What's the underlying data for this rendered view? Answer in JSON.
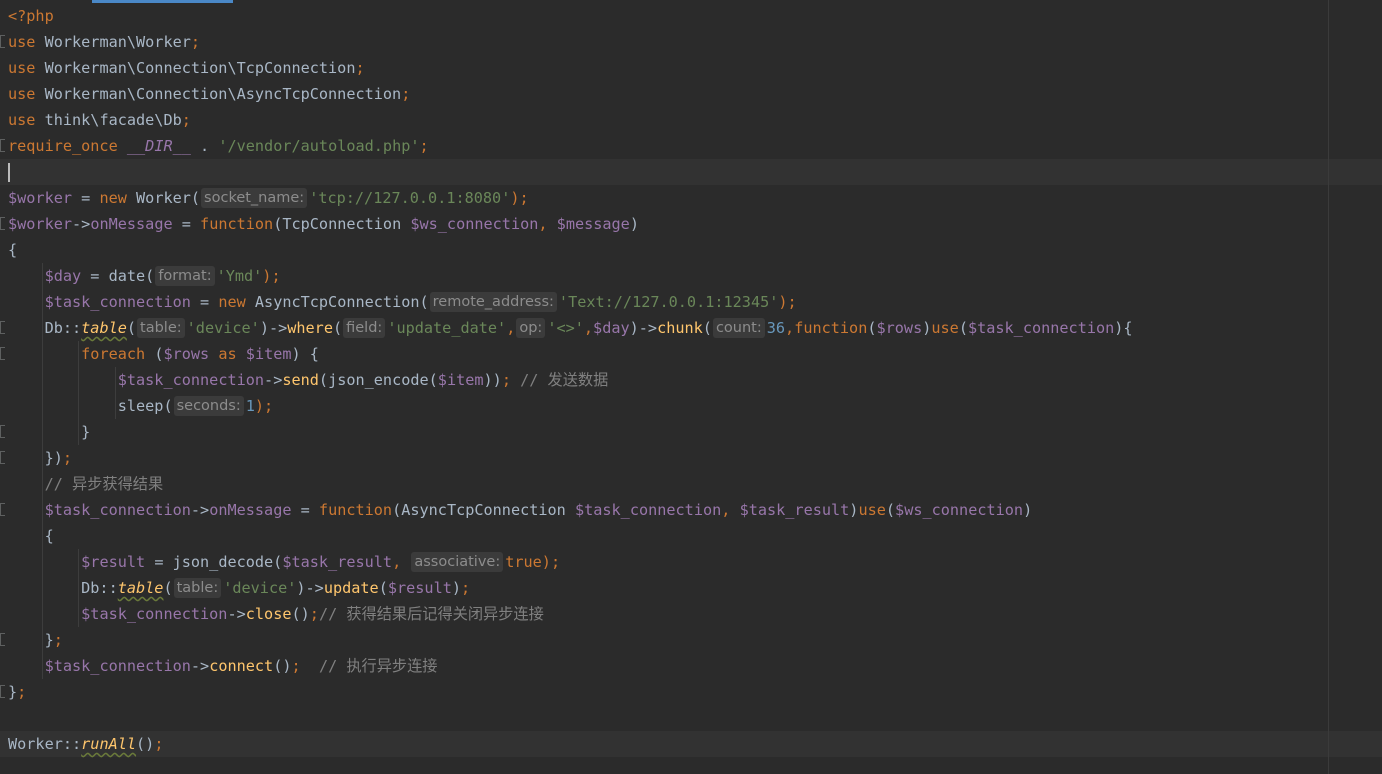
{
  "editor": {
    "lines": [
      [
        {
          "t": "<?php",
          "c": "kw"
        }
      ],
      [
        {
          "t": "use",
          "c": "kw"
        },
        {
          "t": " Workerman\\Worker",
          "c": "txt"
        },
        {
          "t": ";",
          "c": "kw"
        }
      ],
      [
        {
          "t": "use",
          "c": "kw"
        },
        {
          "t": " Workerman\\Connection\\TcpConnection",
          "c": "txt"
        },
        {
          "t": ";",
          "c": "kw"
        }
      ],
      [
        {
          "t": "use",
          "c": "kw"
        },
        {
          "t": " Workerman\\Connection\\AsyncTcpConnection",
          "c": "txt"
        },
        {
          "t": ";",
          "c": "kw"
        }
      ],
      [
        {
          "t": "use",
          "c": "kw"
        },
        {
          "t": " think\\facade\\Db",
          "c": "txt"
        },
        {
          "t": ";",
          "c": "kw"
        }
      ],
      [
        {
          "t": "require_once",
          "c": "kw"
        },
        {
          "t": " ",
          "c": "txt"
        },
        {
          "t": "__DIR__",
          "c": "magic"
        },
        {
          "t": " . ",
          "c": "txt"
        },
        {
          "t": "'/vendor/autoload.php'",
          "c": "str"
        },
        {
          "t": ";",
          "c": "kw"
        }
      ],
      [],
      [
        {
          "t": "$worker",
          "c": "var"
        },
        {
          "t": " = ",
          "c": "txt"
        },
        {
          "t": "new",
          "c": "kw"
        },
        {
          "t": " Worker(",
          "c": "txt"
        },
        {
          "t": "socket_name:",
          "c": "hint"
        },
        {
          "t": "'tcp://127.0.0.1:8080'",
          "c": "str"
        },
        {
          "t": ");",
          "c": "kw"
        }
      ],
      [
        {
          "t": "$worker",
          "c": "var"
        },
        {
          "t": "->",
          "c": "txt"
        },
        {
          "t": "onMessage",
          "c": "var"
        },
        {
          "t": " = ",
          "c": "txt"
        },
        {
          "t": "function",
          "c": "kw"
        },
        {
          "t": "(TcpConnection ",
          "c": "txt"
        },
        {
          "t": "$ws_connection",
          "c": "var"
        },
        {
          "t": ", ",
          "c": "kw"
        },
        {
          "t": "$message",
          "c": "var"
        },
        {
          "t": ")",
          "c": "txt"
        }
      ],
      [
        {
          "t": "{",
          "c": "txt"
        }
      ],
      [
        {
          "t": "    ",
          "c": "txt"
        },
        {
          "t": "$day",
          "c": "var"
        },
        {
          "t": " = date(",
          "c": "txt"
        },
        {
          "t": "format:",
          "c": "hint"
        },
        {
          "t": "'Ymd'",
          "c": "str"
        },
        {
          "t": ");",
          "c": "kw"
        }
      ],
      [
        {
          "t": "    ",
          "c": "txt"
        },
        {
          "t": "$task_connection",
          "c": "var"
        },
        {
          "t": " = ",
          "c": "txt"
        },
        {
          "t": "new",
          "c": "kw"
        },
        {
          "t": " AsyncTcpConnection(",
          "c": "txt"
        },
        {
          "t": "remote_address:",
          "c": "hint"
        },
        {
          "t": "'Text://127.0.0.1:12345'",
          "c": "str"
        },
        {
          "t": ");",
          "c": "kw"
        }
      ],
      [
        {
          "t": "    Db::",
          "c": "txt"
        },
        {
          "t": "table",
          "c": "stfn"
        },
        {
          "t": "(",
          "c": "txt"
        },
        {
          "t": "table:",
          "c": "hint"
        },
        {
          "t": "'device'",
          "c": "str"
        },
        {
          "t": ")->",
          "c": "txt"
        },
        {
          "t": "where",
          "c": "fn"
        },
        {
          "t": "(",
          "c": "txt"
        },
        {
          "t": "field:",
          "c": "hint"
        },
        {
          "t": "'update_date'",
          "c": "str"
        },
        {
          "t": ",",
          "c": "kw"
        },
        {
          "t": "op:",
          "c": "hint"
        },
        {
          "t": "'<>'",
          "c": "str"
        },
        {
          "t": ",",
          "c": "kw"
        },
        {
          "t": "$day",
          "c": "var"
        },
        {
          "t": ")->",
          "c": "txt"
        },
        {
          "t": "chunk",
          "c": "fn"
        },
        {
          "t": "(",
          "c": "txt"
        },
        {
          "t": "count:",
          "c": "hint"
        },
        {
          "t": "36",
          "c": "num"
        },
        {
          "t": ",",
          "c": "kw"
        },
        {
          "t": "function",
          "c": "kw"
        },
        {
          "t": "(",
          "c": "txt"
        },
        {
          "t": "$rows",
          "c": "var"
        },
        {
          "t": ")",
          "c": "txt"
        },
        {
          "t": "use",
          "c": "kw"
        },
        {
          "t": "(",
          "c": "txt"
        },
        {
          "t": "$task_connection",
          "c": "var"
        },
        {
          "t": "){",
          "c": "txt"
        }
      ],
      [
        {
          "t": "        ",
          "c": "txt"
        },
        {
          "t": "foreach",
          "c": "kw"
        },
        {
          "t": " (",
          "c": "txt"
        },
        {
          "t": "$rows",
          "c": "var"
        },
        {
          "t": " ",
          "c": "txt"
        },
        {
          "t": "as",
          "c": "kw"
        },
        {
          "t": " ",
          "c": "txt"
        },
        {
          "t": "$item",
          "c": "var"
        },
        {
          "t": ") {",
          "c": "txt"
        }
      ],
      [
        {
          "t": "            ",
          "c": "txt"
        },
        {
          "t": "$task_connection",
          "c": "var"
        },
        {
          "t": "->",
          "c": "txt"
        },
        {
          "t": "send",
          "c": "fn"
        },
        {
          "t": "(json_encode(",
          "c": "txt"
        },
        {
          "t": "$item",
          "c": "var"
        },
        {
          "t": "))",
          "c": "txt"
        },
        {
          "t": ";",
          "c": "kw"
        },
        {
          "t": " // 发送数据",
          "c": "cm"
        }
      ],
      [
        {
          "t": "            sleep(",
          "c": "txt"
        },
        {
          "t": "seconds:",
          "c": "hint"
        },
        {
          "t": "1",
          "c": "num"
        },
        {
          "t": ");",
          "c": "kw"
        }
      ],
      [
        {
          "t": "        }",
          "c": "txt"
        }
      ],
      [
        {
          "t": "    })",
          "c": "txt"
        },
        {
          "t": ";",
          "c": "kw"
        }
      ],
      [
        {
          "t": "    // 异步获得结果",
          "c": "cm"
        }
      ],
      [
        {
          "t": "    ",
          "c": "txt"
        },
        {
          "t": "$task_connection",
          "c": "var"
        },
        {
          "t": "->",
          "c": "txt"
        },
        {
          "t": "onMessage",
          "c": "var"
        },
        {
          "t": " = ",
          "c": "txt"
        },
        {
          "t": "function",
          "c": "kw"
        },
        {
          "t": "(AsyncTcpConnection ",
          "c": "txt"
        },
        {
          "t": "$task_connection",
          "c": "var"
        },
        {
          "t": ", ",
          "c": "kw"
        },
        {
          "t": "$task_result",
          "c": "var"
        },
        {
          "t": ")",
          "c": "txt"
        },
        {
          "t": "use",
          "c": "kw"
        },
        {
          "t": "(",
          "c": "txt"
        },
        {
          "t": "$ws_connection",
          "c": "var"
        },
        {
          "t": ")",
          "c": "txt"
        }
      ],
      [
        {
          "t": "    {",
          "c": "txt"
        }
      ],
      [
        {
          "t": "        ",
          "c": "txt"
        },
        {
          "t": "$result",
          "c": "var"
        },
        {
          "t": " = json_decode(",
          "c": "txt"
        },
        {
          "t": "$task_result",
          "c": "var"
        },
        {
          "t": ", ",
          "c": "kw"
        },
        {
          "t": "associative:",
          "c": "hint"
        },
        {
          "t": "true",
          "c": "kw"
        },
        {
          "t": ");",
          "c": "kw"
        }
      ],
      [
        {
          "t": "        Db::",
          "c": "txt"
        },
        {
          "t": "table",
          "c": "stfn"
        },
        {
          "t": "(",
          "c": "txt"
        },
        {
          "t": "table:",
          "c": "hint"
        },
        {
          "t": "'device'",
          "c": "str"
        },
        {
          "t": ")->",
          "c": "txt"
        },
        {
          "t": "update",
          "c": "fn"
        },
        {
          "t": "(",
          "c": "txt"
        },
        {
          "t": "$result",
          "c": "var"
        },
        {
          "t": ")",
          "c": "txt"
        },
        {
          "t": ";",
          "c": "kw"
        }
      ],
      [
        {
          "t": "        ",
          "c": "txt"
        },
        {
          "t": "$task_connection",
          "c": "var"
        },
        {
          "t": "->",
          "c": "txt"
        },
        {
          "t": "close",
          "c": "fn"
        },
        {
          "t": "()",
          "c": "txt"
        },
        {
          "t": ";",
          "c": "kw"
        },
        {
          "t": "// 获得结果后记得关闭异步连接",
          "c": "cm"
        }
      ],
      [
        {
          "t": "    }",
          "c": "txt"
        },
        {
          "t": ";",
          "c": "kw"
        }
      ],
      [
        {
          "t": "    ",
          "c": "txt"
        },
        {
          "t": "$task_connection",
          "c": "var"
        },
        {
          "t": "->",
          "c": "txt"
        },
        {
          "t": "connect",
          "c": "fn"
        },
        {
          "t": "()",
          "c": "txt"
        },
        {
          "t": ";",
          "c": "kw"
        },
        {
          "t": "  // 执行异步连接",
          "c": "cm"
        }
      ],
      [
        {
          "t": "}",
          "c": "txt"
        },
        {
          "t": ";",
          "c": "kw"
        }
      ],
      [],
      [
        {
          "t": "Worker::",
          "c": "txt"
        },
        {
          "t": "runAll",
          "c": "stfn"
        },
        {
          "t": "()",
          "c": "txt"
        },
        {
          "t": ";",
          "c": "kw"
        }
      ]
    ],
    "current_line": 6,
    "highlight_lines": [
      6,
      28
    ],
    "fold_lines": [
      1,
      5,
      8,
      12,
      13,
      16,
      17,
      19,
      24,
      26
    ],
    "colors": {
      "background": "#2b2b2b",
      "keyword": "#cc7832",
      "variable": "#9876aa",
      "string": "#6a8759",
      "number": "#6897bb",
      "function": "#ffc66d",
      "comment": "#808080",
      "text": "#a9b7c6",
      "hint_bg": "#3b3b3b"
    }
  }
}
